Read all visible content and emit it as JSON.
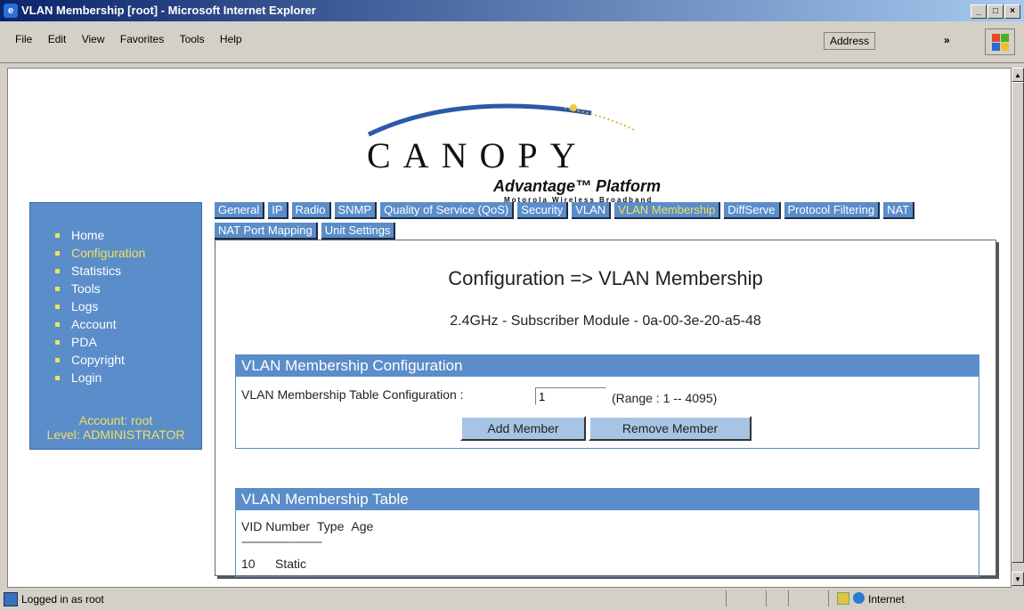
{
  "window": {
    "title": "VLAN Membership [root] - Microsoft Internet Explorer",
    "menu": [
      "File",
      "Edit",
      "View",
      "Favorites",
      "Tools",
      "Help"
    ],
    "address_label": "Address",
    "chevron": "»"
  },
  "logo": {
    "word": "CANOPY",
    "tm": "™",
    "platform": "Advantage™ Platform",
    "tagline": "Motorola Wireless Broadband"
  },
  "sidebar": {
    "items": [
      {
        "label": "Home"
      },
      {
        "label": "Configuration",
        "active": true
      },
      {
        "label": "Statistics"
      },
      {
        "label": "Tools"
      },
      {
        "label": "Logs"
      },
      {
        "label": "Account"
      },
      {
        "label": "PDA"
      },
      {
        "label": "Copyright"
      },
      {
        "label": "Login"
      }
    ],
    "account": "Account: root",
    "level": "Level: ADMINISTRATOR"
  },
  "tabs": [
    {
      "label": "General"
    },
    {
      "label": "IP"
    },
    {
      "label": "Radio"
    },
    {
      "label": "SNMP"
    },
    {
      "label": "Quality of Service (QoS)"
    },
    {
      "label": "Security"
    },
    {
      "label": "VLAN"
    },
    {
      "label": "VLAN Membership",
      "active": true
    },
    {
      "label": "DiffServe"
    },
    {
      "label": "Protocol Filtering"
    },
    {
      "label": "NAT"
    },
    {
      "label": "NAT Port Mapping"
    },
    {
      "label": "Unit Settings"
    }
  ],
  "main": {
    "heading": "Configuration => VLAN Membership",
    "subheading": "2.4GHz - Subscriber Module - 0a-00-3e-20-a5-48"
  },
  "config": {
    "title": "VLAN Membership Configuration",
    "field_label": "VLAN Membership Table Configuration :",
    "field_value": "1",
    "range": "(Range : 1 -- 4095)",
    "add_button": "Add Member",
    "remove_button": "Remove Member"
  },
  "table": {
    "title": "VLAN Membership Table",
    "headers": [
      "VID Number",
      "Type",
      "Age"
    ],
    "divider": "------------------------------",
    "rows": [
      [
        "10",
        "Static"
      ]
    ]
  },
  "status": {
    "text": "Logged in as root",
    "zone": "Internet"
  },
  "colors": {
    "accent": "#5a8dc9",
    "highlight": "#f0e060"
  }
}
